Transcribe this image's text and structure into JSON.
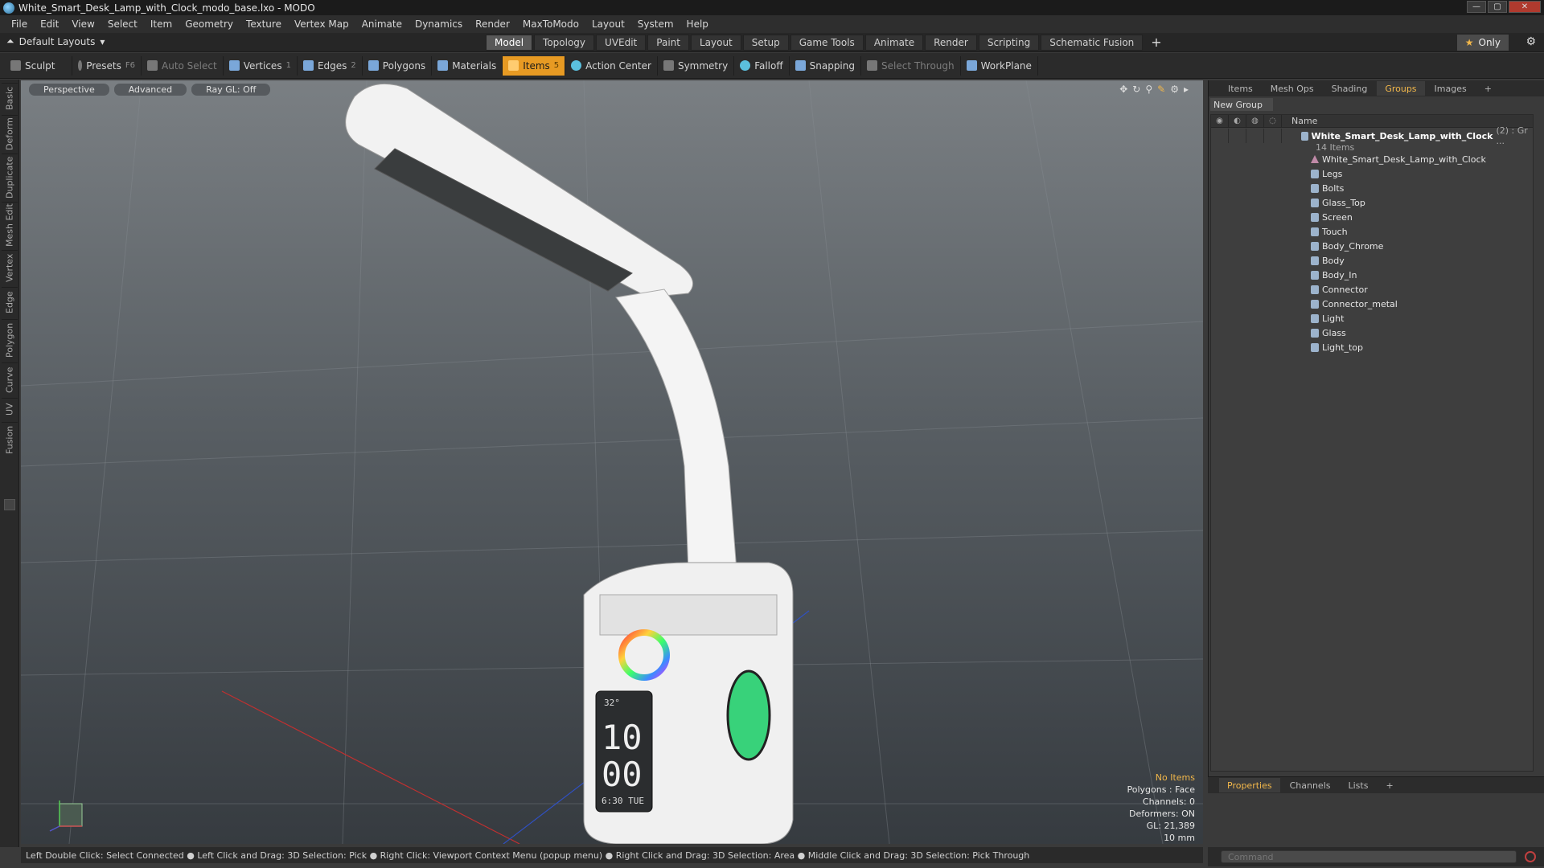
{
  "window": {
    "title": "White_Smart_Desk_Lamp_with_Clock_modo_base.lxo - MODO",
    "controls": [
      "—",
      "▢",
      "✕"
    ]
  },
  "menu": [
    "File",
    "Edit",
    "View",
    "Select",
    "Item",
    "Geometry",
    "Texture",
    "Vertex Map",
    "Animate",
    "Dynamics",
    "Render",
    "MaxToModo",
    "Layout",
    "System",
    "Help"
  ],
  "layout": {
    "selector": "Default Layouts",
    "tabs": [
      "Model",
      "Topology",
      "UVEdit",
      "Paint",
      "Layout",
      "Setup",
      "Game Tools",
      "Animate",
      "Render",
      "Scripting",
      "Schematic Fusion"
    ],
    "active_tab": "Model",
    "only_label": "Only"
  },
  "toolbar": {
    "sculpt": "Sculpt",
    "presets": "Presets",
    "presets_key": "F6",
    "auto_select": "Auto Select",
    "vertices": "Vertices",
    "vertices_key": "1",
    "edges": "Edges",
    "edges_key": "2",
    "polygons": "Polygons",
    "materials": "Materials",
    "items": "Items",
    "items_key": "5",
    "action_center": "Action Center",
    "symmetry": "Symmetry",
    "falloff": "Falloff",
    "snapping": "Snapping",
    "select_through": "Select Through",
    "workplane": "WorkPlane"
  },
  "left_tabs": [
    "Basic",
    "Deform",
    "Duplicate",
    "Mesh Edit",
    "Vertex",
    "Edge",
    "Polygon",
    "Curve",
    "UV",
    "Fusion"
  ],
  "viewport": {
    "buttons": [
      "Perspective",
      "Advanced",
      "Ray GL: Off"
    ],
    "stats": {
      "no_items": "No Items",
      "polygons": "Polygons : Face",
      "channels": "Channels: 0",
      "deformers": "Deformers: ON",
      "gl": "GL: 21,389",
      "scale": "10 mm"
    },
    "clock": {
      "top": "32°",
      "hours": "10",
      "minutes": "00",
      "date": "6:30 TUE"
    }
  },
  "status_bar": "Left Double Click: Select Connected ● Left Click and Drag: 3D Selection: Pick ● Right Click: Viewport Context Menu (popup menu) ● Right Click and Drag: 3D Selection: Area ● Middle Click and Drag: 3D Selection: Pick Through",
  "right_panel": {
    "tabs": [
      "Items",
      "Mesh Ops",
      "Shading",
      "Groups",
      "Images"
    ],
    "active_tab": "Groups",
    "new_group": "New Group",
    "name_header": "Name",
    "group": {
      "name": "White_Smart_Desk_Lamp_with_Clock",
      "count": "(2) : Gr ...",
      "sub": "14 Items"
    },
    "items": [
      "White_Smart_Desk_Lamp_with_Clock",
      "Legs",
      "Bolts",
      "Glass_Top",
      "Screen",
      "Touch",
      "Body_Chrome",
      "Body",
      "Body_In",
      "Connector",
      "Connector_metal",
      "Light",
      "Glass",
      "Light_top"
    ]
  },
  "properties": {
    "tabs": [
      "Properties",
      "Channels",
      "Lists"
    ],
    "active_tab": "Properties"
  },
  "command": {
    "placeholder": "Command"
  },
  "colors": {
    "accent": "#e79a23",
    "tab_active_text": "#f2b74a"
  }
}
